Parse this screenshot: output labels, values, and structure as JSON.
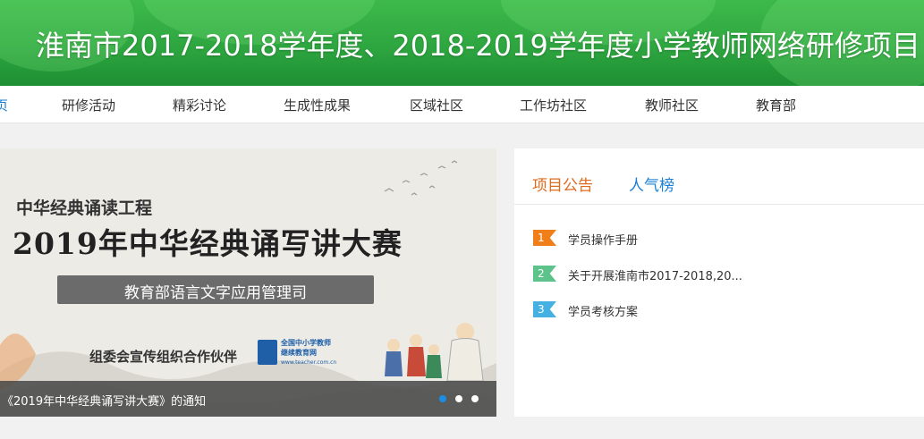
{
  "header": {
    "title": "淮南市2017-2018学年度、2018-2019学年度小学教师网络研修项目"
  },
  "nav": {
    "items": [
      {
        "label": "页",
        "active": true
      },
      {
        "label": "研修活动"
      },
      {
        "label": "精彩讨论"
      },
      {
        "label": "生成性成果"
      },
      {
        "label": "区域社区"
      },
      {
        "label": "工作坊社区"
      },
      {
        "label": "教师社区"
      },
      {
        "label": "教育部"
      }
    ]
  },
  "banner": {
    "subtitle": "中华经典诵读工程",
    "headline": "2019年中华经典诵写讲大赛",
    "ribbon": "教育部语言文字应用管理司",
    "partner": "组委会宣传组织合作伙伴",
    "logo_text_1": "全国中小学教师",
    "logo_text_2": "继续教育网",
    "logo_text_3": "www.teacher.com.cn",
    "caption": "《2019年中华经典诵写讲大赛》的通知",
    "dots": [
      {
        "active": true
      },
      {
        "active": false
      },
      {
        "active": false
      }
    ]
  },
  "panel": {
    "tabs": [
      {
        "label": "项目公告",
        "active": true
      },
      {
        "label": "人气榜",
        "active": false
      }
    ],
    "items": [
      {
        "num": "1",
        "text": "学员操作手册",
        "color": "#f07f1a"
      },
      {
        "num": "2",
        "text": "关于开展淮南市2017-2018,20...",
        "color": "#5cc38a"
      },
      {
        "num": "3",
        "text": "学员考核方案",
        "color": "#45b1e3"
      }
    ]
  }
}
